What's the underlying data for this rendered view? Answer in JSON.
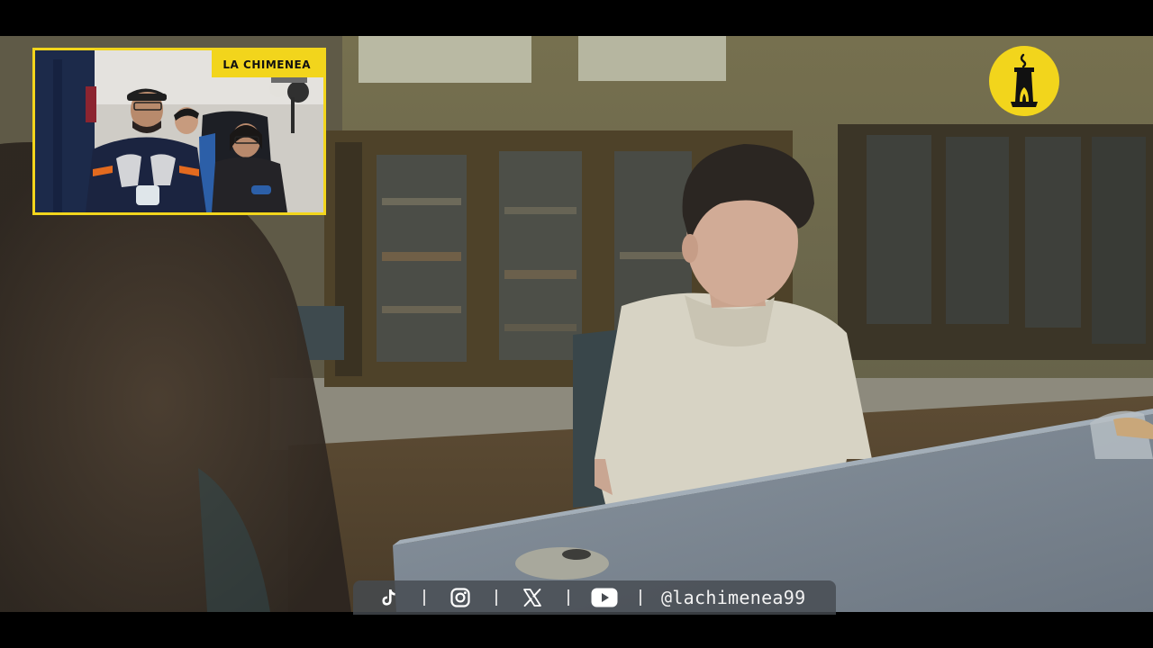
{
  "overlay": {
    "channel_label": "LA CHIMENEA",
    "brand_logo_icon": "chimney-logo-icon",
    "accent_color": "#f2d51c"
  },
  "social_bar": {
    "icons": [
      "tiktok-icon",
      "instagram-icon",
      "x-icon",
      "youtube-icon"
    ],
    "handle": "@lachimenea99"
  },
  "video": {
    "scene": "classroom-scene",
    "webcam": "streamer-webcam"
  }
}
